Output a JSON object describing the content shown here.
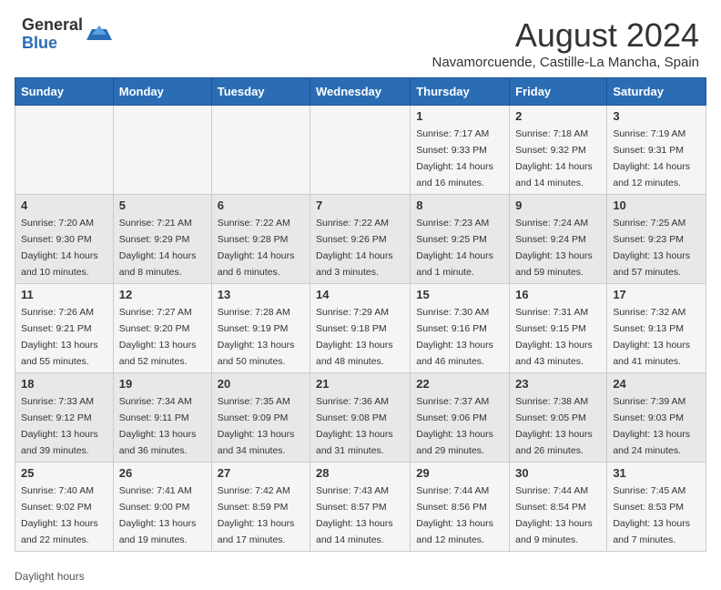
{
  "logo": {
    "general": "General",
    "blue": "Blue"
  },
  "title": "August 2024",
  "subtitle": "Navamorcuende, Castille-La Mancha, Spain",
  "days_of_week": [
    "Sunday",
    "Monday",
    "Tuesday",
    "Wednesday",
    "Thursday",
    "Friday",
    "Saturday"
  ],
  "weeks": [
    [
      {
        "day": "",
        "info": ""
      },
      {
        "day": "",
        "info": ""
      },
      {
        "day": "",
        "info": ""
      },
      {
        "day": "",
        "info": ""
      },
      {
        "day": "1",
        "info": "Sunrise: 7:17 AM\nSunset: 9:33 PM\nDaylight: 14 hours and 16 minutes."
      },
      {
        "day": "2",
        "info": "Sunrise: 7:18 AM\nSunset: 9:32 PM\nDaylight: 14 hours and 14 minutes."
      },
      {
        "day": "3",
        "info": "Sunrise: 7:19 AM\nSunset: 9:31 PM\nDaylight: 14 hours and 12 minutes."
      }
    ],
    [
      {
        "day": "4",
        "info": "Sunrise: 7:20 AM\nSunset: 9:30 PM\nDaylight: 14 hours and 10 minutes."
      },
      {
        "day": "5",
        "info": "Sunrise: 7:21 AM\nSunset: 9:29 PM\nDaylight: 14 hours and 8 minutes."
      },
      {
        "day": "6",
        "info": "Sunrise: 7:22 AM\nSunset: 9:28 PM\nDaylight: 14 hours and 6 minutes."
      },
      {
        "day": "7",
        "info": "Sunrise: 7:22 AM\nSunset: 9:26 PM\nDaylight: 14 hours and 3 minutes."
      },
      {
        "day": "8",
        "info": "Sunrise: 7:23 AM\nSunset: 9:25 PM\nDaylight: 14 hours and 1 minute."
      },
      {
        "day": "9",
        "info": "Sunrise: 7:24 AM\nSunset: 9:24 PM\nDaylight: 13 hours and 59 minutes."
      },
      {
        "day": "10",
        "info": "Sunrise: 7:25 AM\nSunset: 9:23 PM\nDaylight: 13 hours and 57 minutes."
      }
    ],
    [
      {
        "day": "11",
        "info": "Sunrise: 7:26 AM\nSunset: 9:21 PM\nDaylight: 13 hours and 55 minutes."
      },
      {
        "day": "12",
        "info": "Sunrise: 7:27 AM\nSunset: 9:20 PM\nDaylight: 13 hours and 52 minutes."
      },
      {
        "day": "13",
        "info": "Sunrise: 7:28 AM\nSunset: 9:19 PM\nDaylight: 13 hours and 50 minutes."
      },
      {
        "day": "14",
        "info": "Sunrise: 7:29 AM\nSunset: 9:18 PM\nDaylight: 13 hours and 48 minutes."
      },
      {
        "day": "15",
        "info": "Sunrise: 7:30 AM\nSunset: 9:16 PM\nDaylight: 13 hours and 46 minutes."
      },
      {
        "day": "16",
        "info": "Sunrise: 7:31 AM\nSunset: 9:15 PM\nDaylight: 13 hours and 43 minutes."
      },
      {
        "day": "17",
        "info": "Sunrise: 7:32 AM\nSunset: 9:13 PM\nDaylight: 13 hours and 41 minutes."
      }
    ],
    [
      {
        "day": "18",
        "info": "Sunrise: 7:33 AM\nSunset: 9:12 PM\nDaylight: 13 hours and 39 minutes."
      },
      {
        "day": "19",
        "info": "Sunrise: 7:34 AM\nSunset: 9:11 PM\nDaylight: 13 hours and 36 minutes."
      },
      {
        "day": "20",
        "info": "Sunrise: 7:35 AM\nSunset: 9:09 PM\nDaylight: 13 hours and 34 minutes."
      },
      {
        "day": "21",
        "info": "Sunrise: 7:36 AM\nSunset: 9:08 PM\nDaylight: 13 hours and 31 minutes."
      },
      {
        "day": "22",
        "info": "Sunrise: 7:37 AM\nSunset: 9:06 PM\nDaylight: 13 hours and 29 minutes."
      },
      {
        "day": "23",
        "info": "Sunrise: 7:38 AM\nSunset: 9:05 PM\nDaylight: 13 hours and 26 minutes."
      },
      {
        "day": "24",
        "info": "Sunrise: 7:39 AM\nSunset: 9:03 PM\nDaylight: 13 hours and 24 minutes."
      }
    ],
    [
      {
        "day": "25",
        "info": "Sunrise: 7:40 AM\nSunset: 9:02 PM\nDaylight: 13 hours and 22 minutes."
      },
      {
        "day": "26",
        "info": "Sunrise: 7:41 AM\nSunset: 9:00 PM\nDaylight: 13 hours and 19 minutes."
      },
      {
        "day": "27",
        "info": "Sunrise: 7:42 AM\nSunset: 8:59 PM\nDaylight: 13 hours and 17 minutes."
      },
      {
        "day": "28",
        "info": "Sunrise: 7:43 AM\nSunset: 8:57 PM\nDaylight: 13 hours and 14 minutes."
      },
      {
        "day": "29",
        "info": "Sunrise: 7:44 AM\nSunset: 8:56 PM\nDaylight: 13 hours and 12 minutes."
      },
      {
        "day": "30",
        "info": "Sunrise: 7:44 AM\nSunset: 8:54 PM\nDaylight: 13 hours and 9 minutes."
      },
      {
        "day": "31",
        "info": "Sunrise: 7:45 AM\nSunset: 8:53 PM\nDaylight: 13 hours and 7 minutes."
      }
    ]
  ],
  "footer": "Daylight hours"
}
